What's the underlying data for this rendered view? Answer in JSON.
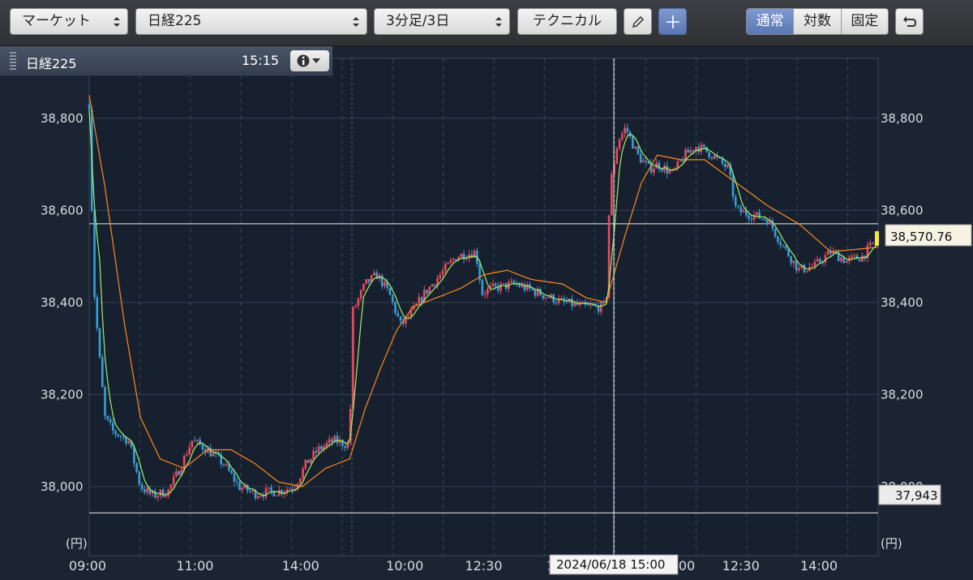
{
  "toolbar": {
    "market_label": "マーケット",
    "symbol_label": "日経225",
    "interval_label": "3分足/3日",
    "technical_label": "テクニカル",
    "scale_normal": "通常",
    "scale_log": "対数",
    "scale_fixed": "固定"
  },
  "infobar": {
    "title": "日経225",
    "time": "15:15"
  },
  "chart_data": {
    "type": "candlestick",
    "ylim": [
      37850,
      38930
    ],
    "yticks": [
      38000,
      38200,
      38400,
      38600,
      38800
    ],
    "ytick_labels": [
      "38,000",
      "38,200",
      "38,400",
      "38,600",
      "38,800"
    ],
    "yunit_left": "(円)",
    "yunit_right": "(円)",
    "xtick_labels": [
      "09:00",
      "11:00",
      "14:00",
      "10:00",
      "12:30",
      "1",
      "00",
      "12:30",
      "14:00"
    ],
    "price_keypoints": [
      [
        0,
        38830
      ],
      [
        0.006,
        38430
      ],
      [
        0.012,
        38300
      ],
      [
        0.02,
        38150
      ],
      [
        0.03,
        38120
      ],
      [
        0.05,
        38100
      ],
      [
        0.065,
        38000
      ],
      [
        0.08,
        37980
      ],
      [
        0.1,
        37990
      ],
      [
        0.115,
        38040
      ],
      [
        0.13,
        38100
      ],
      [
        0.15,
        38080
      ],
      [
        0.17,
        38050
      ],
      [
        0.19,
        38000
      ],
      [
        0.21,
        37985
      ],
      [
        0.24,
        37990
      ],
      [
        0.26,
        38000
      ],
      [
        0.275,
        38050
      ],
      [
        0.29,
        38080
      ],
      [
        0.31,
        38100
      ],
      [
        0.33,
        38090
      ],
      [
        0.334,
        38380
      ],
      [
        0.35,
        38440
      ],
      [
        0.365,
        38460
      ],
      [
        0.38,
        38420
      ],
      [
        0.395,
        38350
      ],
      [
        0.41,
        38380
      ],
      [
        0.425,
        38420
      ],
      [
        0.445,
        38460
      ],
      [
        0.465,
        38500
      ],
      [
        0.49,
        38510
      ],
      [
        0.498,
        38420
      ],
      [
        0.51,
        38430
      ],
      [
        0.54,
        38440
      ],
      [
        0.57,
        38420
      ],
      [
        0.6,
        38400
      ],
      [
        0.63,
        38390
      ],
      [
        0.655,
        38390
      ],
      [
        0.66,
        38650
      ],
      [
        0.67,
        38750
      ],
      [
        0.68,
        38780
      ],
      [
        0.695,
        38720
      ],
      [
        0.71,
        38690
      ],
      [
        0.72,
        38700
      ],
      [
        0.74,
        38680
      ],
      [
        0.755,
        38720
      ],
      [
        0.77,
        38740
      ],
      [
        0.79,
        38720
      ],
      [
        0.81,
        38690
      ],
      [
        0.82,
        38600
      ],
      [
        0.84,
        38590
      ],
      [
        0.86,
        38580
      ],
      [
        0.88,
        38520
      ],
      [
        0.9,
        38470
      ],
      [
        0.92,
        38480
      ],
      [
        0.94,
        38510
      ],
      [
        0.96,
        38490
      ],
      [
        0.98,
        38500
      ],
      [
        1,
        38540
      ]
    ],
    "orange_ma_keypoints": [
      [
        0,
        38850
      ],
      [
        0.02,
        38650
      ],
      [
        0.045,
        38350
      ],
      [
        0.065,
        38150
      ],
      [
        0.09,
        38060
      ],
      [
        0.12,
        38040
      ],
      [
        0.15,
        38080
      ],
      [
        0.18,
        38080
      ],
      [
        0.21,
        38050
      ],
      [
        0.24,
        38010
      ],
      [
        0.27,
        38000
      ],
      [
        0.3,
        38040
      ],
      [
        0.33,
        38060
      ],
      [
        0.35,
        38170
      ],
      [
        0.37,
        38260
      ],
      [
        0.39,
        38340
      ],
      [
        0.41,
        38390
      ],
      [
        0.44,
        38410
      ],
      [
        0.47,
        38430
      ],
      [
        0.5,
        38460
      ],
      [
        0.53,
        38470
      ],
      [
        0.56,
        38450
      ],
      [
        0.6,
        38440
      ],
      [
        0.63,
        38410
      ],
      [
        0.655,
        38400
      ],
      [
        0.68,
        38550
      ],
      [
        0.7,
        38660
      ],
      [
        0.72,
        38720
      ],
      [
        0.75,
        38710
      ],
      [
        0.78,
        38710
      ],
      [
        0.82,
        38660
      ],
      [
        0.86,
        38610
      ],
      [
        0.9,
        38570
      ],
      [
        0.94,
        38510
      ],
      [
        1,
        38520
      ]
    ],
    "current_price": 38570.76,
    "current_price_label": "38,570.76",
    "low_price": 37943,
    "low_price_label": "37,943",
    "crosshair_label": "2024/06/18 15:00"
  }
}
